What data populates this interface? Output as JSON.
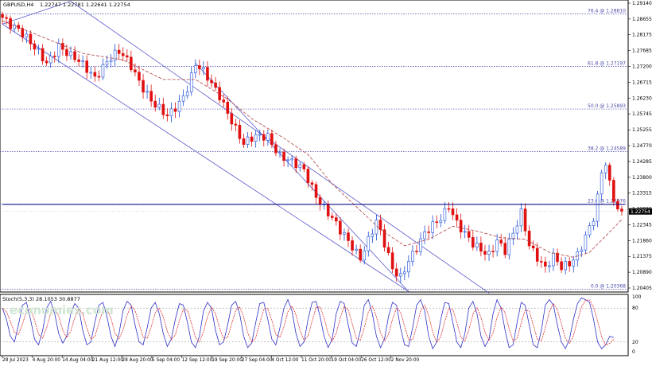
{
  "header": {
    "symbol": "GBPUSD,H4",
    "ohlc": "1.22747 1.22781 1.22641 1.22754"
  },
  "indicator": {
    "label": "Stoch(5,3,3) 28.1053 30.8877",
    "levels": [
      "100",
      "80",
      "20",
      "0"
    ]
  },
  "watermark": "economies.com",
  "colors": {
    "bull": "#1f4fd6",
    "bear": "#e01010",
    "ma": "#b04040",
    "fib": "#4a4aa8",
    "channel": "#5a5acc",
    "stoch_main": "#3030c8",
    "stoch_signal": "#e03030",
    "price_tag_bg": "#000000"
  },
  "chart_data": {
    "type": "candlestick",
    "ylim": [
      1.20405,
      1.2914
    ],
    "price_ticks": [
      "1.29140",
      "1.28655",
      "1.28175",
      "1.27685",
      "1.27200",
      "1.26715",
      "1.26230",
      "1.25745",
      "1.25255",
      "1.24770",
      "1.24285",
      "1.23800",
      "1.23315",
      "1.22830",
      "1.22345",
      "1.21860",
      "1.21375",
      "1.20890",
      "1.20405"
    ],
    "current_price": "1.22754",
    "resistance_level": 1.2297,
    "fib_levels": [
      {
        "label": "76.4 @ 1.28810",
        "value": 1.2881
      },
      {
        "label": "61.8 @ 1.27197",
        "value": 1.27197
      },
      {
        "label": "50.0 @ 1.25893",
        "value": 1.25893
      },
      {
        "label": "38.2 @ 1.24589",
        "value": 1.24589
      },
      {
        "label": "23.6 @ 1.22976",
        "value": 1.22976
      },
      {
        "label": "0.0 @ 1.20368",
        "value": 1.20368
      }
    ],
    "date_labels": [
      "28 Jul 2023",
      "4 Aug 20:00",
      "14 Aug 04:00",
      "21 Aug 12:00",
      "28 Aug 20:00",
      "5 Sep 04:00",
      "12 Sep 12:00",
      "19 Sep 20:00",
      "27 Sep 04:00",
      "4 Oct 12:00",
      "11 Oct 20:00",
      "19 Oct 04:00",
      "26 Oct 12:00",
      "2 Nov 20:00"
    ],
    "close_path": [
      [
        0,
        1.287
      ],
      [
        4,
        1.284
      ],
      [
        8,
        1.277
      ],
      [
        11,
        1.273
      ],
      [
        14,
        1.279
      ],
      [
        17,
        1.275
      ],
      [
        20,
        1.272
      ],
      [
        23,
        1.269
      ],
      [
        26,
        1.274
      ],
      [
        29,
        1.276
      ],
      [
        32,
        1.272
      ],
      [
        35,
        1.266
      ],
      [
        38,
        1.26
      ],
      [
        41,
        1.256
      ],
      [
        44,
        1.261
      ],
      [
        46,
        1.266
      ],
      [
        48,
        1.273
      ],
      [
        50,
        1.27
      ],
      [
        52,
        1.266
      ],
      [
        54,
        1.263
      ],
      [
        57,
        1.256
      ],
      [
        60,
        1.248
      ],
      [
        63,
        1.25
      ],
      [
        66,
        1.251
      ],
      [
        69,
        1.245
      ],
      [
        72,
        1.242
      ],
      [
        75,
        1.24
      ],
      [
        78,
        1.233
      ],
      [
        81,
        1.227
      ],
      [
        84,
        1.221
      ],
      [
        87,
        1.217
      ],
      [
        89,
        1.214
      ],
      [
        91,
        1.219
      ],
      [
        93,
        1.224
      ],
      [
        95,
        1.217
      ],
      [
        97,
        1.21
      ],
      [
        99,
        1.208
      ],
      [
        101,
        1.213
      ],
      [
        103,
        1.216
      ],
      [
        105,
        1.22
      ],
      [
        107,
        1.223
      ],
      [
        109,
        1.226
      ],
      [
        111,
        1.23
      ],
      [
        113,
        1.224
      ],
      [
        115,
        1.22
      ],
      [
        117,
        1.217
      ],
      [
        119,
        1.216
      ],
      [
        121,
        1.215
      ],
      [
        123,
        1.219
      ],
      [
        125,
        1.215
      ],
      [
        127,
        1.22
      ],
      [
        129,
        1.227
      ],
      [
        131,
        1.218
      ],
      [
        133,
        1.214
      ],
      [
        135,
        1.21
      ],
      [
        137,
        1.213
      ],
      [
        139,
        1.21
      ],
      [
        141,
        1.212
      ],
      [
        143,
        1.215
      ],
      [
        145,
        1.22
      ],
      [
        147,
        1.225
      ],
      [
        148,
        1.231
      ],
      [
        149,
        1.239
      ],
      [
        150,
        1.242
      ],
      [
        151,
        1.236
      ],
      [
        152,
        1.232
      ],
      [
        153,
        1.229
      ],
      [
        154,
        1.2275
      ]
    ],
    "ma_path": [
      [
        0,
        1.286
      ],
      [
        10,
        1.281
      ],
      [
        20,
        1.276
      ],
      [
        30,
        1.274
      ],
      [
        40,
        1.268
      ],
      [
        48,
        1.268
      ],
      [
        56,
        1.262
      ],
      [
        62,
        1.256
      ],
      [
        70,
        1.25
      ],
      [
        76,
        1.245
      ],
      [
        82,
        1.236
      ],
      [
        88,
        1.229
      ],
      [
        94,
        1.222
      ],
      [
        100,
        1.217
      ],
      [
        106,
        1.219
      ],
      [
        112,
        1.223
      ],
      [
        118,
        1.2215
      ],
      [
        124,
        1.2195
      ],
      [
        130,
        1.219
      ],
      [
        136,
        1.215
      ],
      [
        142,
        1.2135
      ],
      [
        146,
        1.215
      ],
      [
        150,
        1.22
      ],
      [
        154,
        1.225
      ]
    ],
    "channel": {
      "line_a": [
        [
          0,
          1.285
        ],
        [
          17,
          1.292
        ]
      ],
      "line_b": [
        [
          17,
          1.292
        ],
        [
          121,
          1.2025
        ]
      ],
      "line_c": [
        [
          48,
          1.273
        ],
        [
          101,
          1.203
        ]
      ],
      "line_d": [
        [
          0,
          1.285
        ],
        [
          101,
          1.203
        ]
      ]
    },
    "stoch_k": [
      80,
      60,
      30,
      20,
      50,
      85,
      90,
      60,
      25,
      15,
      40,
      80,
      92,
      70,
      35,
      18,
      30,
      70,
      88,
      80,
      40,
      15,
      20,
      55,
      85,
      90,
      65,
      30,
      12,
      35,
      75,
      92,
      85,
      50,
      20,
      15,
      45,
      80,
      90,
      70,
      35,
      12,
      25,
      60,
      88,
      85,
      55,
      20,
      10,
      30,
      75,
      90,
      80,
      40,
      15,
      20,
      50,
      85,
      92,
      70,
      30,
      10,
      18,
      55,
      88,
      90,
      60,
      25,
      15,
      45,
      80,
      95,
      75,
      35,
      12,
      20,
      60,
      90,
      92,
      65,
      30,
      10,
      25,
      70,
      92,
      88,
      50,
      18,
      12,
      40,
      85,
      95,
      70,
      30,
      10,
      25,
      65,
      90,
      85,
      45,
      15,
      12,
      45,
      85,
      95,
      75,
      30,
      8,
      20,
      60,
      90,
      88,
      55,
      20,
      10,
      35,
      80,
      92,
      70,
      30,
      12,
      25,
      70,
      95,
      80,
      40,
      10,
      15,
      55,
      90,
      85,
      50,
      15,
      10,
      40,
      85,
      95,
      85,
      50,
      20,
      8,
      25,
      60,
      88,
      98,
      95,
      90,
      60,
      20,
      8,
      15,
      30,
      28
    ]
  }
}
